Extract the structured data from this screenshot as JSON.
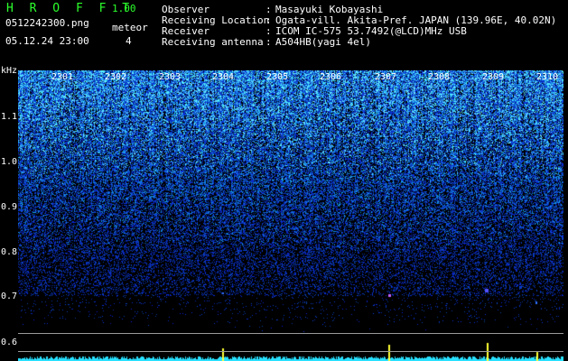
{
  "header": {
    "app_name": "H R O F F T",
    "version": "1.00",
    "filename": "0512242300.png",
    "mode_label": "meteor",
    "datetime": "05.12.24 23:00",
    "count": "4",
    "observer_label": "Observer",
    "observer_value": "Masayuki Kobayashi",
    "location_label": "Receiving Location",
    "location_value": "Ogata-vill. Akita-Pref. JAPAN (139.96E, 40.02N)",
    "receiver_label": "Receiver",
    "receiver_value": "ICOM IC-575 53.7492(@LCD)MHz USB",
    "antenna_label": "Receiving antenna",
    "antenna_value": "A504HB(yagi 4el)",
    "colon": ":"
  },
  "axis": {
    "unit": "kHz",
    "y_ticks": [
      "1.1",
      "1.0",
      "0.9",
      "0.8",
      "0.7",
      "0.6"
    ],
    "x_ticks": [
      "2301",
      "2302",
      "2303",
      "2304",
      "2305",
      "2306",
      "2307",
      "2308",
      "2309",
      "2310"
    ]
  },
  "colors": {
    "text_green": "#2cff2c",
    "background": "#000000",
    "noise_high": "#4ad0ff",
    "noise_mid": "#1a3cc8",
    "trace": "#28e0ff",
    "echo": "#ffff33"
  }
}
